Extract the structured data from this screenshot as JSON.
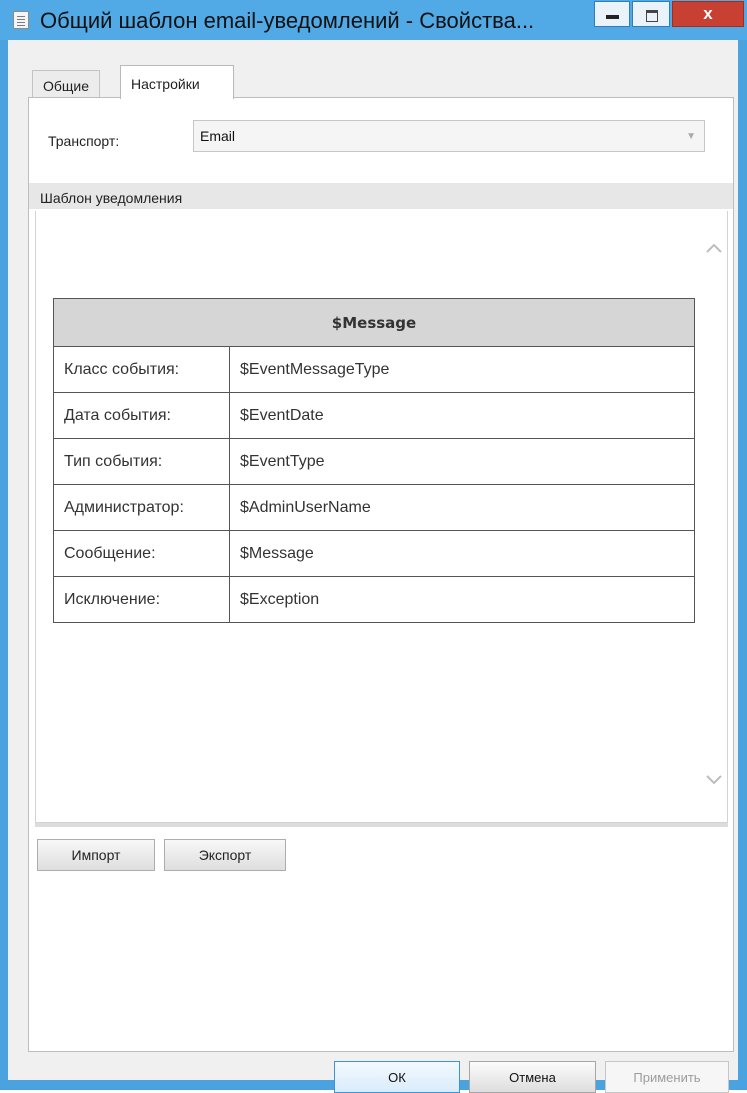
{
  "window": {
    "title": "Общий шаблон email-уведомлений - Свойства...",
    "close_glyph": "x"
  },
  "tabs": [
    {
      "label": "Общие"
    },
    {
      "label": "Настройки"
    }
  ],
  "settings": {
    "transport_label": "Транспорт:",
    "transport_value": "Email",
    "section_header": "Шаблон уведомления"
  },
  "template_table": {
    "header": "$Message",
    "rows": [
      {
        "label": "Класс события:",
        "value": "$EventMessageType"
      },
      {
        "label": "Дата события:",
        "value": "$EventDate"
      },
      {
        "label": "Тип события:",
        "value": "$EventType"
      },
      {
        "label": "Администратор:",
        "value": "$AdminUserName"
      },
      {
        "label": "Сообщение:",
        "value": "$Message"
      },
      {
        "label": "Исключение:",
        "value": "$Exception"
      }
    ]
  },
  "actions": {
    "import_label": "Импорт",
    "export_label": "Экспорт"
  },
  "dialog_buttons": {
    "ok_label": "ОК",
    "cancel_label": "Отмена",
    "apply_label": "Применить"
  },
  "icons": {
    "window": "document-icon",
    "minimize": "minimize-icon",
    "maximize": "maximize-icon",
    "close": "close-icon",
    "dropdown": "chevron-down-icon",
    "scroll_up": "chevron-up-icon",
    "scroll_down": "chevron-down-icon"
  },
  "colors": {
    "titlebar": "#51a9e6",
    "close_button": "#c84031"
  }
}
